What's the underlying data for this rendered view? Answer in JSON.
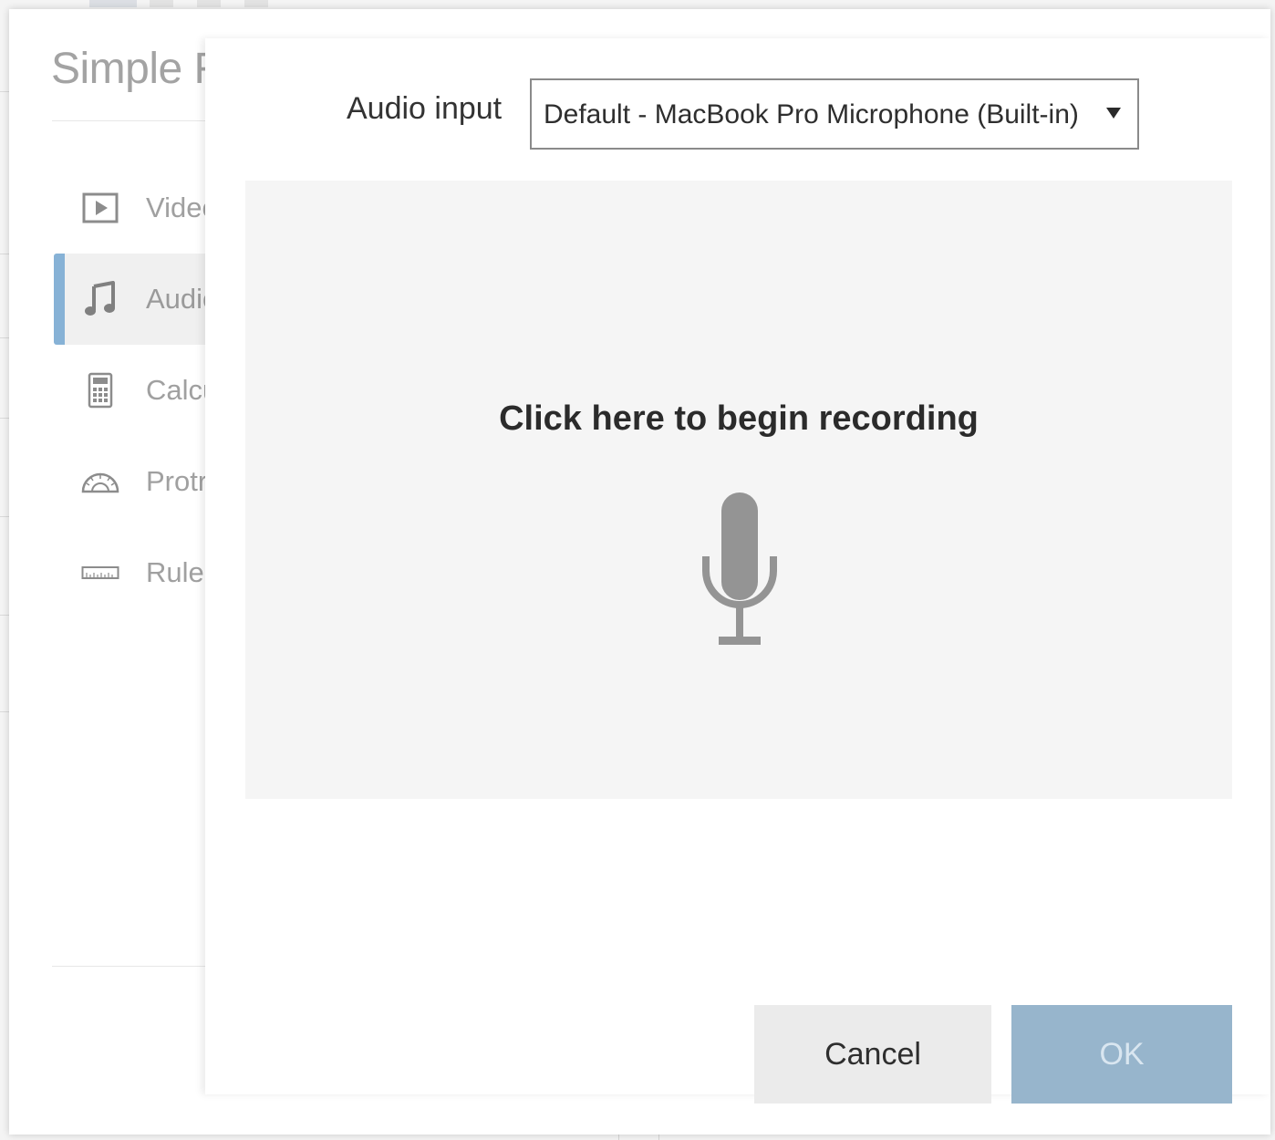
{
  "sidebar": {
    "title": "Simple F",
    "items": [
      {
        "label": "Video",
        "icon": "play-icon",
        "active": false
      },
      {
        "label": "Audio",
        "icon": "music-note-icon",
        "active": true
      },
      {
        "label": "Calculator",
        "icon": "calculator-icon",
        "active": false
      },
      {
        "label": "Protractor",
        "icon": "protractor-icon",
        "active": false
      },
      {
        "label": "Ruler",
        "icon": "ruler-icon",
        "active": false
      }
    ]
  },
  "audio_input": {
    "label": "Audio input",
    "selected": "Default - MacBook Pro Microphone (Built-in)"
  },
  "recorder": {
    "prompt": "Click here to begin recording",
    "icon": "microphone-icon"
  },
  "actions": {
    "cancel_label": "Cancel",
    "ok_label": "OK"
  },
  "colors": {
    "accent": "#87b2d6",
    "ok_button": "#97b5cc",
    "record_area": "#f5f5f5"
  }
}
